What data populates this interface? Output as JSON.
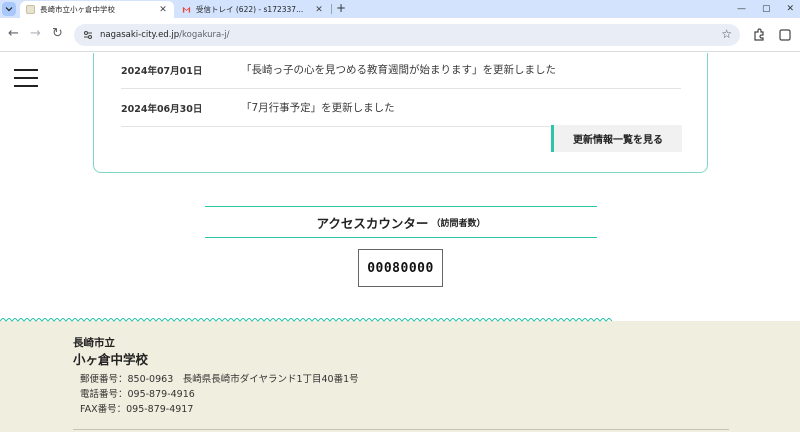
{
  "browser": {
    "tabs": [
      {
        "title": "長崎市立小ヶ倉中学校",
        "active": true
      },
      {
        "title": "受信トレイ (622) - s172337...",
        "active": false
      }
    ],
    "url_host": "nagasaki-city.ed.jp",
    "url_path": "/kogakura-j/"
  },
  "news": {
    "items": [
      {
        "date": "2024年07月01日",
        "title": "「長崎っ子の心を見つめる教育週間が始まります」を更新しました"
      },
      {
        "date": "2024年06月30日",
        "title": "「7月行事予定」を更新しました"
      }
    ],
    "more_label": "更新情報一覧を見る"
  },
  "counter": {
    "title": "アクセスカウンター",
    "subtitle": "（訪問者数）",
    "value": "00080000"
  },
  "footer": {
    "city": "長崎市立",
    "school": "小ヶ倉中学校",
    "postal": "郵便番号：850-0963　長崎県長崎市ダイヤランド1丁目40番1号",
    "phone": "電話番号：095-879-4916",
    "fax": "FAX番号：095-879-4917"
  },
  "colors": {
    "accent": "#2ec4a9",
    "footer_bg": "#f0eedf",
    "chrome_tabbar": "#d3e3fd"
  }
}
